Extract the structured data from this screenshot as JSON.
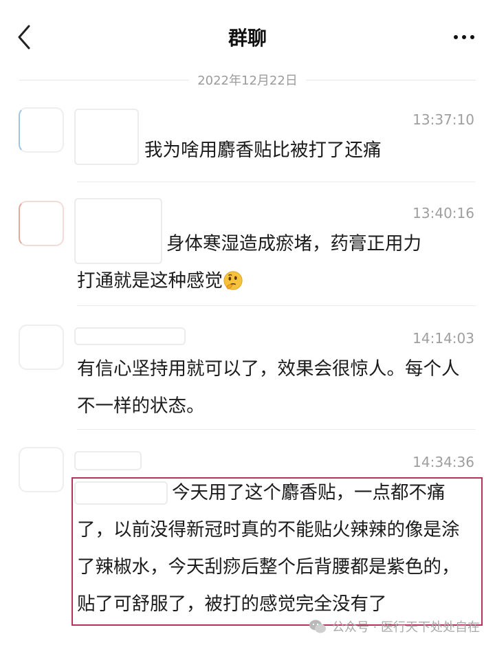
{
  "header": {
    "title": "群聊"
  },
  "date_separator": "2022年12月22日",
  "messages": [
    {
      "time": "13:37:10",
      "text": "我为啥用麝香贴比被打了还痛"
    },
    {
      "time": "13:40:16",
      "text_line1": "身体寒湿造成瘀堵，药膏正用力",
      "text_line2": "打通就是这种感觉"
    },
    {
      "time": "14:14:03",
      "text": "有信心坚持用就可以了，效果会很惊人。每个人不一样的状态。"
    },
    {
      "time": "14:34:36",
      "text_line1": "今天用了这个麝香贴，一点都不",
      "text_rest": "痛了，以前没得新冠时真的不能贴火辣辣的像是涂了辣椒水，今天刮痧后整个后背腰都是紫色的，贴了可舒服了，被打的感觉完全没有了"
    }
  ],
  "icons": {
    "back": "chevron-left-icon",
    "more": "more-dots-icon",
    "emoji": "thinking-face-emoji",
    "watermark": "wechat-icon"
  },
  "colors": {
    "highlight_border": "#b5325a",
    "timestamp": "#9e9e9e"
  },
  "watermark": {
    "text": "公众号 · 医行天下处处自在"
  }
}
